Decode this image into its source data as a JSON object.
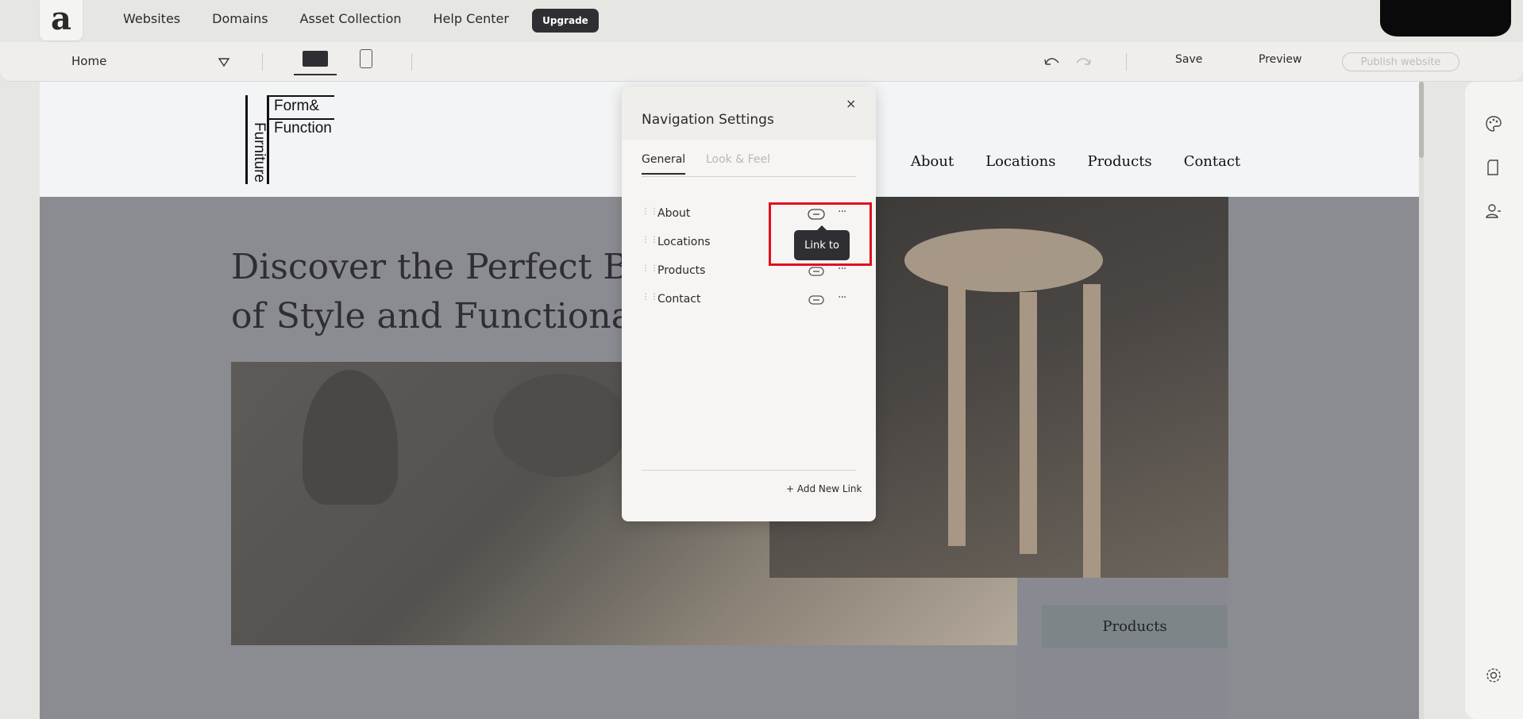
{
  "topbar": {
    "logo": "a",
    "nav": [
      "Websites",
      "Domains",
      "Asset Collection",
      "Help Center"
    ],
    "upgrade_label": "Upgrade"
  },
  "editor_bar": {
    "page": "Home",
    "save_label": "Save",
    "preview_label": "Preview",
    "publish_label": "Publish website"
  },
  "site": {
    "logo_lines": [
      "Form&",
      "Function",
      "Furniture"
    ],
    "nav": [
      "About",
      "Locations",
      "Products",
      "Contact"
    ],
    "hero_title_line1": "Discover the Perfect Bl",
    "hero_title_line2": "of Style and Functiona",
    "products_button": "Products"
  },
  "panel": {
    "title": "Navigation Settings",
    "close": "×",
    "tabs": [
      "General",
      "Look & Feel"
    ],
    "items": [
      "About",
      "Locations",
      "Products",
      "Contact"
    ],
    "more": "···",
    "add_link": "+ Add New Link"
  },
  "tooltip": "Link to"
}
